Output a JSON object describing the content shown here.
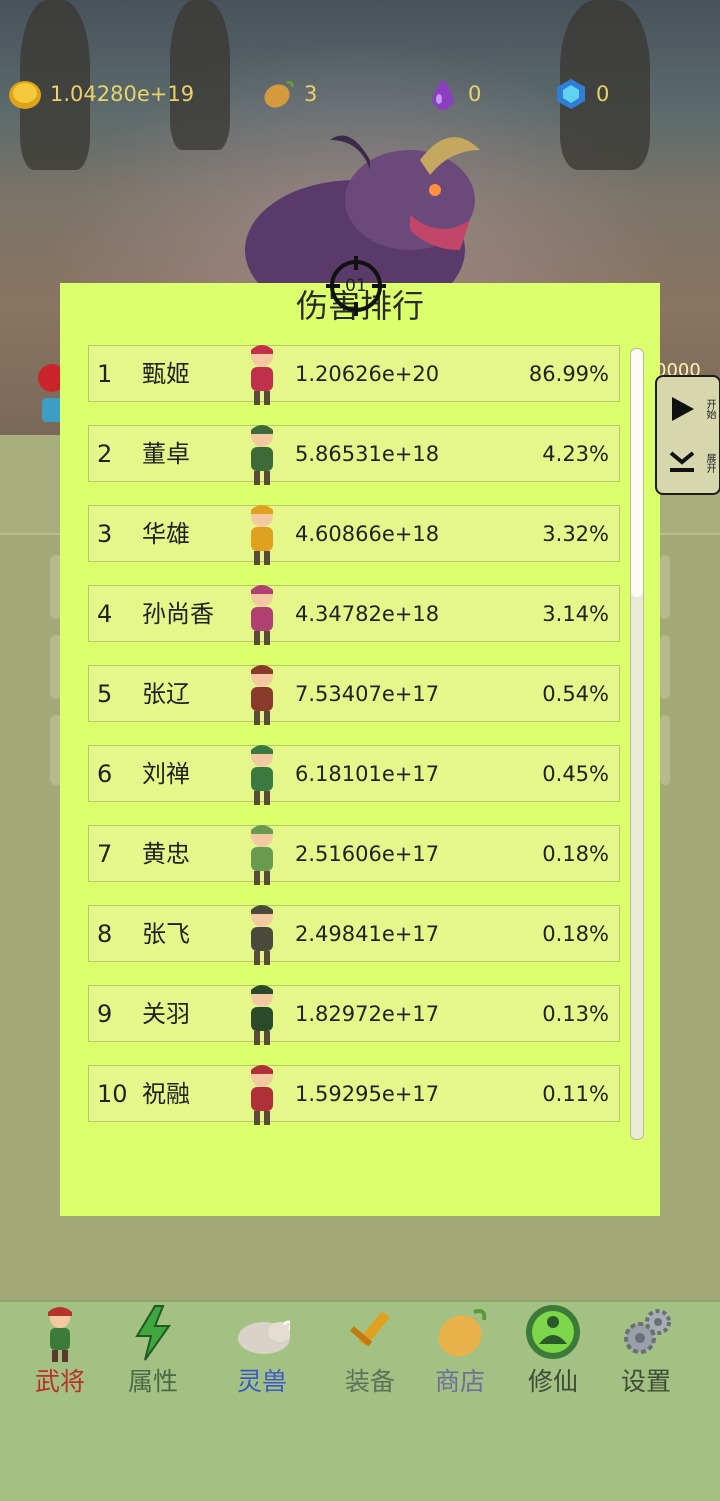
{
  "resources": [
    {
      "icon": "gold-coin-icon",
      "value": "1.04280e+19"
    },
    {
      "icon": "mango-icon",
      "value": "3"
    },
    {
      "icon": "purple-drop-icon",
      "value": "0"
    },
    {
      "icon": "blue-gem-icon",
      "value": "0"
    }
  ],
  "hud": {
    "right_value": "0000"
  },
  "target": {
    "label": "01"
  },
  "side_controls": {
    "start_label": "开始",
    "expand_label": "展开"
  },
  "ranking": {
    "title": "伤害排行",
    "rows": [
      {
        "rank": "1",
        "name": "甄姬",
        "damage": "1.20626e+20",
        "percent": "86.99%"
      },
      {
        "rank": "2",
        "name": "董卓",
        "damage": "5.86531e+18",
        "percent": "4.23%"
      },
      {
        "rank": "3",
        "name": "华雄",
        "damage": "4.60866e+18",
        "percent": "3.32%"
      },
      {
        "rank": "4",
        "name": "孙尚香",
        "damage": "4.34782e+18",
        "percent": "3.14%"
      },
      {
        "rank": "5",
        "name": "张辽",
        "damage": "7.53407e+17",
        "percent": "0.54%"
      },
      {
        "rank": "6",
        "name": "刘禅",
        "damage": "6.18101e+17",
        "percent": "0.45%"
      },
      {
        "rank": "7",
        "name": "黄忠",
        "damage": "2.51606e+17",
        "percent": "0.18%"
      },
      {
        "rank": "8",
        "name": "张飞",
        "damage": "2.49841e+17",
        "percent": "0.18%"
      },
      {
        "rank": "9",
        "name": "关羽",
        "damage": "1.82972e+17",
        "percent": "0.13%"
      },
      {
        "rank": "10",
        "name": "祝融",
        "damage": "1.59295e+17",
        "percent": "0.11%"
      }
    ]
  },
  "nav": [
    {
      "label": "武将",
      "icon": "general-icon",
      "color": "#b7322a"
    },
    {
      "label": "属性",
      "icon": "lightning-icon",
      "color": "#4a6a44"
    },
    {
      "label": "灵兽",
      "icon": "beast-icon",
      "color": "#3e58c8"
    },
    {
      "label": "装备",
      "icon": "sword-icon",
      "color": "#5d7257"
    },
    {
      "label": "商店",
      "icon": "mango-icon",
      "color": "#6e6f9a"
    },
    {
      "label": "修仙",
      "icon": "meditation-icon",
      "color": "#3d4b37"
    },
    {
      "label": "设置",
      "icon": "gear-icon",
      "color": "#3d4b37"
    }
  ]
}
